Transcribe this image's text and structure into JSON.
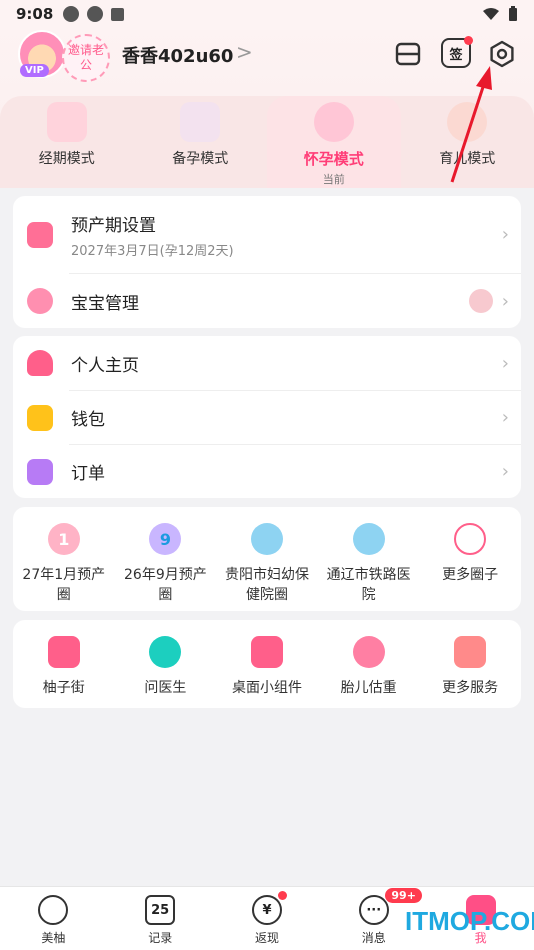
{
  "status_bar": {
    "time": "9:08"
  },
  "header": {
    "vip_label": "VIP",
    "invite_text": "邀请老公",
    "username": "香香402u60",
    "chevron": ">",
    "checkin_label": "签"
  },
  "modes": [
    {
      "label": "经期模式",
      "sub": ""
    },
    {
      "label": "备孕模式",
      "sub": ""
    },
    {
      "label": "怀孕模式",
      "sub": "当前"
    },
    {
      "label": "育儿模式",
      "sub": ""
    }
  ],
  "card1": {
    "due_date": {
      "label": "预产期设置",
      "sub": "2027年3月7日(孕12周2天)"
    },
    "baby": {
      "label": "宝宝管理"
    }
  },
  "card2": {
    "items": [
      {
        "label": "个人主页"
      },
      {
        "label": "钱包"
      },
      {
        "label": "订单"
      }
    ]
  },
  "circles": [
    {
      "label": "27年1月预产圈",
      "icon_text": "1"
    },
    {
      "label": "26年9月预产圈",
      "icon_text": "9"
    },
    {
      "label": "贵阳市妇幼保健院圈",
      "icon_text": ""
    },
    {
      "label": "通辽市铁路医院",
      "icon_text": ""
    },
    {
      "label": "更多圈子",
      "icon_text": ""
    }
  ],
  "services": [
    {
      "label": "柚子街"
    },
    {
      "label": "问医生"
    },
    {
      "label": "桌面小组件"
    },
    {
      "label": "胎儿估重"
    },
    {
      "label": "更多服务"
    }
  ],
  "tabbar": [
    {
      "label": "美柚",
      "icon_text": ""
    },
    {
      "label": "记录",
      "icon_text": "25"
    },
    {
      "label": "返现",
      "icon_text": "¥"
    },
    {
      "label": "消息",
      "icon_text": "···",
      "badge": "99+"
    },
    {
      "label": "我",
      "icon_text": ""
    }
  ],
  "watermark": "ITMOP.COM",
  "colors": {
    "accent": "#ff3d77",
    "badge": "#ff3b4e",
    "watermark": "#1fa9e0",
    "arrow": "#e8192c"
  }
}
